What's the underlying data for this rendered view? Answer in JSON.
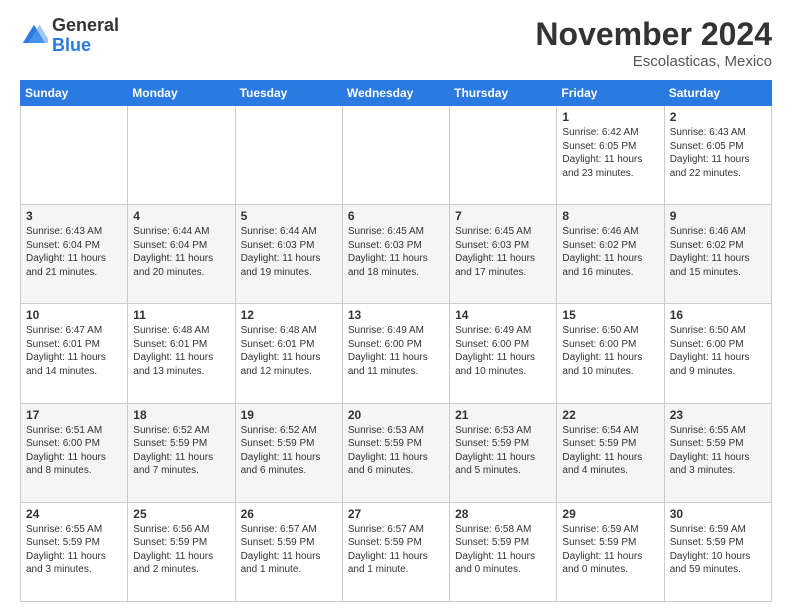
{
  "header": {
    "logo_general": "General",
    "logo_blue": "Blue",
    "month_title": "November 2024",
    "subtitle": "Escolasticas, Mexico"
  },
  "weekdays": [
    "Sunday",
    "Monday",
    "Tuesday",
    "Wednesday",
    "Thursday",
    "Friday",
    "Saturday"
  ],
  "rows": [
    [
      {
        "day": "",
        "info": ""
      },
      {
        "day": "",
        "info": ""
      },
      {
        "day": "",
        "info": ""
      },
      {
        "day": "",
        "info": ""
      },
      {
        "day": "",
        "info": ""
      },
      {
        "day": "1",
        "info": "Sunrise: 6:42 AM\nSunset: 6:05 PM\nDaylight: 11 hours and 23 minutes."
      },
      {
        "day": "2",
        "info": "Sunrise: 6:43 AM\nSunset: 6:05 PM\nDaylight: 11 hours and 22 minutes."
      }
    ],
    [
      {
        "day": "3",
        "info": "Sunrise: 6:43 AM\nSunset: 6:04 PM\nDaylight: 11 hours and 21 minutes."
      },
      {
        "day": "4",
        "info": "Sunrise: 6:44 AM\nSunset: 6:04 PM\nDaylight: 11 hours and 20 minutes."
      },
      {
        "day": "5",
        "info": "Sunrise: 6:44 AM\nSunset: 6:03 PM\nDaylight: 11 hours and 19 minutes."
      },
      {
        "day": "6",
        "info": "Sunrise: 6:45 AM\nSunset: 6:03 PM\nDaylight: 11 hours and 18 minutes."
      },
      {
        "day": "7",
        "info": "Sunrise: 6:45 AM\nSunset: 6:03 PM\nDaylight: 11 hours and 17 minutes."
      },
      {
        "day": "8",
        "info": "Sunrise: 6:46 AM\nSunset: 6:02 PM\nDaylight: 11 hours and 16 minutes."
      },
      {
        "day": "9",
        "info": "Sunrise: 6:46 AM\nSunset: 6:02 PM\nDaylight: 11 hours and 15 minutes."
      }
    ],
    [
      {
        "day": "10",
        "info": "Sunrise: 6:47 AM\nSunset: 6:01 PM\nDaylight: 11 hours and 14 minutes."
      },
      {
        "day": "11",
        "info": "Sunrise: 6:48 AM\nSunset: 6:01 PM\nDaylight: 11 hours and 13 minutes."
      },
      {
        "day": "12",
        "info": "Sunrise: 6:48 AM\nSunset: 6:01 PM\nDaylight: 11 hours and 12 minutes."
      },
      {
        "day": "13",
        "info": "Sunrise: 6:49 AM\nSunset: 6:00 PM\nDaylight: 11 hours and 11 minutes."
      },
      {
        "day": "14",
        "info": "Sunrise: 6:49 AM\nSunset: 6:00 PM\nDaylight: 11 hours and 10 minutes."
      },
      {
        "day": "15",
        "info": "Sunrise: 6:50 AM\nSunset: 6:00 PM\nDaylight: 11 hours and 10 minutes."
      },
      {
        "day": "16",
        "info": "Sunrise: 6:50 AM\nSunset: 6:00 PM\nDaylight: 11 hours and 9 minutes."
      }
    ],
    [
      {
        "day": "17",
        "info": "Sunrise: 6:51 AM\nSunset: 6:00 PM\nDaylight: 11 hours and 8 minutes."
      },
      {
        "day": "18",
        "info": "Sunrise: 6:52 AM\nSunset: 5:59 PM\nDaylight: 11 hours and 7 minutes."
      },
      {
        "day": "19",
        "info": "Sunrise: 6:52 AM\nSunset: 5:59 PM\nDaylight: 11 hours and 6 minutes."
      },
      {
        "day": "20",
        "info": "Sunrise: 6:53 AM\nSunset: 5:59 PM\nDaylight: 11 hours and 6 minutes."
      },
      {
        "day": "21",
        "info": "Sunrise: 6:53 AM\nSunset: 5:59 PM\nDaylight: 11 hours and 5 minutes."
      },
      {
        "day": "22",
        "info": "Sunrise: 6:54 AM\nSunset: 5:59 PM\nDaylight: 11 hours and 4 minutes."
      },
      {
        "day": "23",
        "info": "Sunrise: 6:55 AM\nSunset: 5:59 PM\nDaylight: 11 hours and 3 minutes."
      }
    ],
    [
      {
        "day": "24",
        "info": "Sunrise: 6:55 AM\nSunset: 5:59 PM\nDaylight: 11 hours and 3 minutes."
      },
      {
        "day": "25",
        "info": "Sunrise: 6:56 AM\nSunset: 5:59 PM\nDaylight: 11 hours and 2 minutes."
      },
      {
        "day": "26",
        "info": "Sunrise: 6:57 AM\nSunset: 5:59 PM\nDaylight: 11 hours and 1 minute."
      },
      {
        "day": "27",
        "info": "Sunrise: 6:57 AM\nSunset: 5:59 PM\nDaylight: 11 hours and 1 minute."
      },
      {
        "day": "28",
        "info": "Sunrise: 6:58 AM\nSunset: 5:59 PM\nDaylight: 11 hours and 0 minutes."
      },
      {
        "day": "29",
        "info": "Sunrise: 6:59 AM\nSunset: 5:59 PM\nDaylight: 11 hours and 0 minutes."
      },
      {
        "day": "30",
        "info": "Sunrise: 6:59 AM\nSunset: 5:59 PM\nDaylight: 10 hours and 59 minutes."
      }
    ]
  ]
}
